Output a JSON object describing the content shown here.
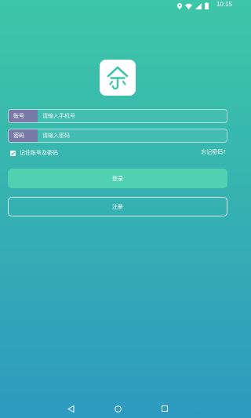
{
  "status": {
    "time": "10:15"
  },
  "icons": {
    "location": "location-icon",
    "wifi": "wifi-icon",
    "signal": "signal-icon",
    "battery": "battery-icon",
    "logo": "umbrella-house-logo-icon",
    "check": "check-icon"
  },
  "colors": {
    "accent": "#4fd1b2",
    "label_bg": "#7a7aa6"
  },
  "form": {
    "account_label": "账号",
    "account_placeholder": "请输入手机号",
    "password_label": "密码",
    "password_placeholder": "请输入密码",
    "remember_label": "记住账号及密码",
    "remember_checked": true,
    "forgot_label": "忘记密码?",
    "login_label": "登录",
    "register_label": "注册"
  }
}
